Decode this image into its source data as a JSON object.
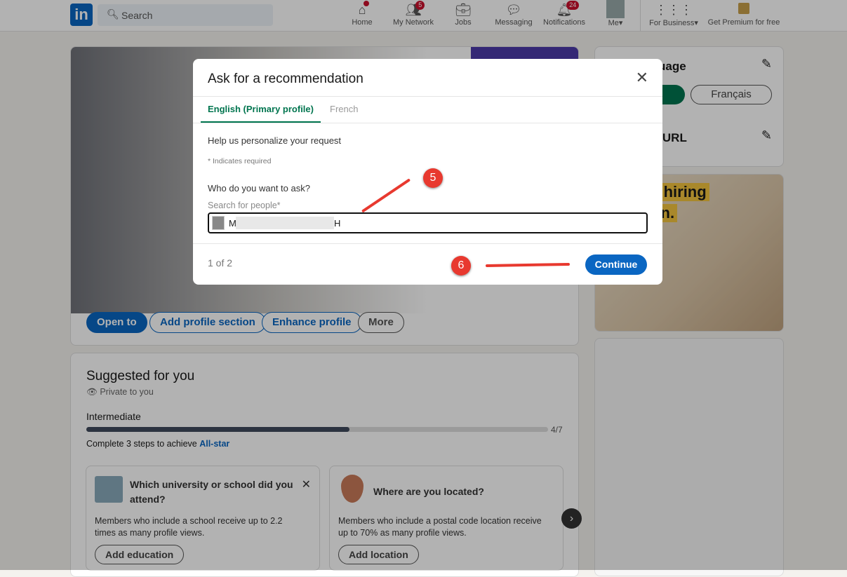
{
  "nav": {
    "search_placeholder": "Search",
    "items": [
      {
        "label": "Home",
        "icon": "home-icon",
        "badge": ""
      },
      {
        "label": "My Network",
        "icon": "network-icon",
        "badge": "5"
      },
      {
        "label": "Jobs",
        "icon": "briefcase-icon",
        "badge": ""
      },
      {
        "label": "Messaging",
        "icon": "chat-icon",
        "badge": ""
      },
      {
        "label": "Notifications",
        "icon": "bell-icon",
        "badge": "24"
      },
      {
        "label": "Me",
        "icon": "avatar-icon",
        "badge": ""
      },
      {
        "label": "For Business",
        "icon": "grid-icon",
        "badge": ""
      },
      {
        "label": "Get Premium for free",
        "icon": "premium-icon",
        "badge": ""
      }
    ]
  },
  "profile": {
    "buttons": [
      "Open to",
      "Add profile section",
      "Enhance profile",
      "More"
    ]
  },
  "right": {
    "language_title": "uage",
    "language_option": "Français",
    "url_title": "le & URL",
    "url_sub": "or",
    "ad_text1": "'s hiring",
    "ad_text2": "dln."
  },
  "suggested": {
    "title": "Suggested for you",
    "private": "Private to you",
    "level": "Intermediate",
    "progress": "4/7",
    "progress_value": 0.57,
    "complete_prefix": "Complete 3 steps to achieve ",
    "complete_link": "All-star",
    "cards": [
      {
        "title": "Which university or school did you attend?",
        "desc": "Members who include a school receive up to 2.2 times as many profile views.",
        "button": "Add education"
      },
      {
        "title": "Where are you located?",
        "desc": "Members who include a postal code location receive up to 70% as many profile views.",
        "button": "Add location"
      }
    ]
  },
  "modal": {
    "title": "Ask for a recommendation",
    "tabs": [
      "English (Primary profile)",
      "French"
    ],
    "intro": "Help us personalize your request",
    "required": "* Indicates required",
    "question": "Who do you want to ask?",
    "field_label": "Search for people*",
    "field_value_start": "M",
    "field_value_end": "H",
    "pager": "1 of 2",
    "continue": "Continue"
  },
  "annotations": {
    "step5": "5",
    "step6": "6"
  },
  "colors": {
    "brand": "#0a66c2",
    "annotation": "#e8392f",
    "tab_active": "#01754f"
  }
}
